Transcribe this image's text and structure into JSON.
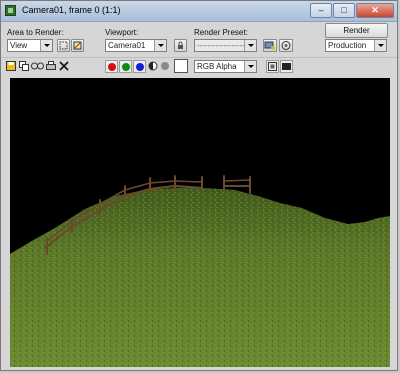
{
  "window": {
    "title": "Camera01, frame 0 (1:1)",
    "icon": "render-frame-window-icon",
    "controls": [
      "minimize-icon",
      "maximize-icon",
      "close-icon"
    ]
  },
  "area_to_render": {
    "label": "Area to Render:",
    "value": "View"
  },
  "viewport": {
    "label": "Viewport:",
    "value": "Camera01"
  },
  "render_preset": {
    "label": "Render Preset:",
    "value": "---------------------"
  },
  "render_button": "Render",
  "production_select": "Production",
  "channel_select": "RGB Alpha",
  "colors": {
    "red_channel": "#d01010",
    "green_channel": "#108a10",
    "blue_channel": "#1020d0",
    "grass": "#5e7a2a",
    "sky": "#000000",
    "fence": "#6b4a2c"
  }
}
